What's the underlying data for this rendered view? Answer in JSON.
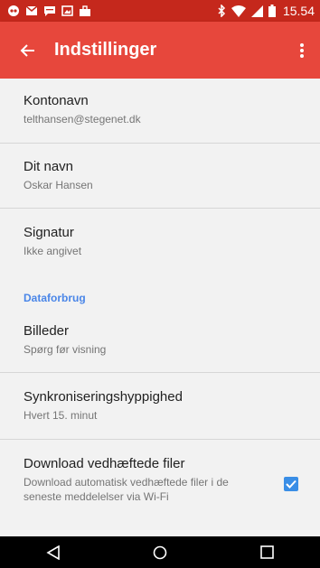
{
  "status_bar": {
    "time": "15.54",
    "left_icons": [
      "chat-icon",
      "mail-icon",
      "message-icon",
      "image-icon",
      "briefcase-icon"
    ],
    "right_icons": [
      "bluetooth-icon",
      "wifi-icon",
      "signal-icon",
      "battery-icon"
    ]
  },
  "app_bar": {
    "title": "Indstillinger",
    "color": "#e7473c",
    "status_color": "#c5281c"
  },
  "settings": {
    "account_name": {
      "title": "Kontonavn",
      "summary": "telthansen@stegenet.dk"
    },
    "your_name": {
      "title": "Dit navn",
      "summary": "Oskar Hansen"
    },
    "signature": {
      "title": "Signatur",
      "summary": "Ikke angivet"
    },
    "category_data": "Dataforbrug",
    "images": {
      "title": "Billeder",
      "summary": "Spørg før visning"
    },
    "sync_frequency": {
      "title": "Synkroniseringshyppighed",
      "summary": "Hvert 15. minut"
    },
    "download_attachments": {
      "title": "Download vedhæftede filer",
      "summary": "Download automatisk vedhæftede filer i de seneste meddelelser via Wi-Fi",
      "checked": true
    }
  },
  "accent_color": "#4a86e8"
}
